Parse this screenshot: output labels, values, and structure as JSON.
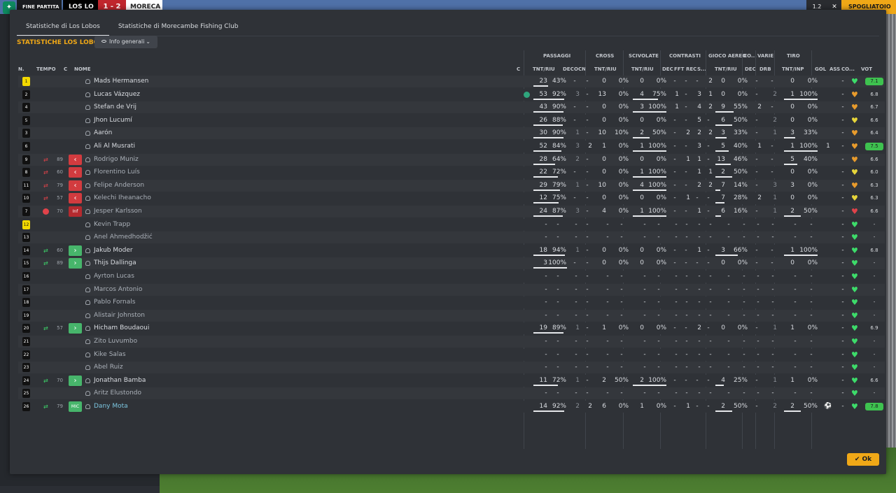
{
  "background": {
    "topbar": {
      "status": "FINE PARTITA",
      "home_team": "LOS LO",
      "score": "1 - 2",
      "away_team": "MORECA",
      "speed": "1.2",
      "close": "✕",
      "button": "SPOGLIATOIO"
    }
  },
  "tabs": [
    {
      "label": "Statistiche di Los Lobos",
      "active": true
    },
    {
      "label": "Statistiche di Morecambe Fishing Club",
      "active": false
    }
  ],
  "section_title": "STATISTICHE LOS LOBOS",
  "view_dropdown": {
    "label": "Info generali"
  },
  "group_headers": [
    "PASSAGGI",
    "CROSS",
    "SCIVOLATE",
    "CONTRASTI",
    "GIOCO AEREO",
    "CO...",
    "VARIE",
    "TIRO"
  ],
  "columns": [
    "N.",
    "TEMPO",
    "C",
    "NOME",
    "C",
    "TNT/RIU",
    "DEC",
    "OCN",
    "TNT/RIU",
    "TNT/RIU",
    "DEC",
    "FFT",
    "REC",
    "S...",
    "TNT/RIU",
    "DEC",
    "DRB",
    "TNT/INP",
    "GOL",
    "ASS",
    "CO...",
    "VOT"
  ],
  "colors": {
    "accent": "#f0a817",
    "heart_green": "#3ddc6a",
    "heart_orange": "#e89b2c",
    "heart_yellow": "#e6d53a",
    "red": "#d23b3f"
  },
  "players": [
    {
      "n": "1",
      "gk": true,
      "time": "",
      "sub": "",
      "chip": "",
      "name": "Mads Hermansen",
      "style": "",
      "cap": false,
      "pass": [
        "23",
        "43%"
      ],
      "pass_dec": "-",
      "pass_ocn": "-",
      "cross": [
        "0",
        "0%"
      ],
      "tackle": [
        "0",
        "0%"
      ],
      "con_dec": "-",
      "con_fft": "-",
      "con_rec": "-",
      "con_s": "2",
      "air": [
        "0",
        "0%"
      ],
      "co": "-",
      "drb": "-",
      "shot": [
        "0",
        "0%"
      ],
      "gol": "",
      "ass": "-",
      "heart": "green",
      "vot": "7.1",
      "vot_bg": "#3ec24f"
    },
    {
      "n": "2",
      "gk": false,
      "time": "",
      "sub": "",
      "chip": "",
      "name": "Lucas Vázquez",
      "style": "",
      "cap": true,
      "pass": [
        "53",
        "92%"
      ],
      "pass_dec": "3",
      "pass_ocn": "-",
      "cross": [
        "13",
        "0%"
      ],
      "tackle": [
        "4",
        "75%"
      ],
      "con_dec": "1",
      "con_fft": "-",
      "con_rec": "3",
      "con_s": "1",
      "air": [
        "0",
        "0%"
      ],
      "co": "-",
      "drb": "2",
      "shot": [
        "1",
        "100%"
      ],
      "gol": "",
      "ass": "-",
      "heart": "orange",
      "vot": "6.8",
      "vot_bg": ""
    },
    {
      "n": "4",
      "gk": false,
      "time": "",
      "sub": "",
      "chip": "",
      "name": "Stefan de Vrij",
      "style": "",
      "cap": false,
      "pass": [
        "43",
        "90%"
      ],
      "pass_dec": "-",
      "pass_ocn": "-",
      "cross": [
        "0",
        "0%"
      ],
      "tackle": [
        "3",
        "100%"
      ],
      "con_dec": "1",
      "con_fft": "-",
      "con_rec": "4",
      "con_s": "2",
      "air": [
        "9",
        "55%"
      ],
      "co": "2",
      "drb": "-",
      "shot": [
        "0",
        "0%"
      ],
      "gol": "",
      "ass": "-",
      "heart": "orange",
      "vot": "6.7",
      "vot_bg": ""
    },
    {
      "n": "5",
      "gk": false,
      "time": "",
      "sub": "",
      "chip": "",
      "name": "Jhon Lucumí",
      "style": "",
      "cap": false,
      "pass": [
        "26",
        "88%"
      ],
      "pass_dec": "-",
      "pass_ocn": "-",
      "cross": [
        "0",
        "0%"
      ],
      "tackle": [
        "0",
        "0%"
      ],
      "con_dec": "-",
      "con_fft": "-",
      "con_rec": "5",
      "con_s": "-",
      "air": [
        "6",
        "50%"
      ],
      "co": "-",
      "drb": "2",
      "shot": [
        "0",
        "0%"
      ],
      "gol": "",
      "ass": "-",
      "heart": "yellow",
      "vot": "6.6",
      "vot_bg": ""
    },
    {
      "n": "3",
      "gk": false,
      "time": "",
      "sub": "",
      "chip": "",
      "name": "Aarón",
      "style": "",
      "cap": false,
      "pass": [
        "30",
        "90%"
      ],
      "pass_dec": "1",
      "pass_ocn": "-",
      "cross": [
        "10",
        "10%"
      ],
      "tackle": [
        "2",
        "50%"
      ],
      "con_dec": "-",
      "con_fft": "2",
      "con_rec": "2",
      "con_s": "2",
      "air": [
        "3",
        "33%"
      ],
      "co": "-",
      "drb": "1",
      "shot": [
        "3",
        "33%"
      ],
      "gol": "",
      "ass": "-",
      "heart": "orange",
      "vot": "6.4",
      "vot_bg": ""
    },
    {
      "n": "6",
      "gk": false,
      "time": "",
      "sub": "",
      "chip": "",
      "name": "Ali Al Musrati",
      "style": "",
      "cap": false,
      "pass": [
        "52",
        "84%"
      ],
      "pass_dec": "3",
      "pass_ocn": "2",
      "cross": [
        "1",
        "0%"
      ],
      "tackle": [
        "1",
        "100%"
      ],
      "con_dec": "-",
      "con_fft": "-",
      "con_rec": "3",
      "con_s": "-",
      "air": [
        "5",
        "40%"
      ],
      "co": "1",
      "drb": "-",
      "shot": [
        "1",
        "100%"
      ],
      "gol": "1",
      "ass": "-",
      "heart": "orange",
      "vot": "7.5",
      "vot_bg": "#3ec24f"
    },
    {
      "n": "9",
      "gk": false,
      "time": "89",
      "sub": "out",
      "chip": "red",
      "name": "Rodrigo Muniz",
      "style": "dim",
      "cap": false,
      "pass": [
        "28",
        "64%"
      ],
      "pass_dec": "2",
      "pass_ocn": "-",
      "cross": [
        "0",
        "0%"
      ],
      "tackle": [
        "0",
        "0%"
      ],
      "con_dec": "-",
      "con_fft": "1",
      "con_rec": "1",
      "con_s": "-",
      "air": [
        "13",
        "46%"
      ],
      "co": "-",
      "drb": "-",
      "shot": [
        "5",
        "40%"
      ],
      "gol": "",
      "ass": "-",
      "heart": "orange",
      "vot": "6.6",
      "vot_bg": ""
    },
    {
      "n": "8",
      "gk": false,
      "time": "60",
      "sub": "out",
      "chip": "red",
      "name": "Florentino Luís",
      "style": "dim",
      "cap": false,
      "pass": [
        "22",
        "72%"
      ],
      "pass_dec": "-",
      "pass_ocn": "-",
      "cross": [
        "0",
        "0%"
      ],
      "tackle": [
        "1",
        "100%"
      ],
      "con_dec": "-",
      "con_fft": "-",
      "con_rec": "1",
      "con_s": "1",
      "air": [
        "2",
        "50%"
      ],
      "co": "-",
      "drb": "-",
      "shot": [
        "0",
        "0%"
      ],
      "gol": "",
      "ass": "-",
      "heart": "yellow",
      "vot": "6.0",
      "vot_bg": ""
    },
    {
      "n": "11",
      "gk": false,
      "time": "79",
      "sub": "out",
      "chip": "red",
      "name": "Felipe Anderson",
      "style": "dim",
      "cap": false,
      "pass": [
        "29",
        "79%"
      ],
      "pass_dec": "1",
      "pass_ocn": "-",
      "cross": [
        "10",
        "0%"
      ],
      "tackle": [
        "4",
        "100%"
      ],
      "con_dec": "-",
      "con_fft": "-",
      "con_rec": "2",
      "con_s": "2",
      "air": [
        "7",
        "14%"
      ],
      "co": "-",
      "drb": "3",
      "shot": [
        "3",
        "0%"
      ],
      "gol": "",
      "ass": "-",
      "heart": "orange",
      "vot": "6.3",
      "vot_bg": ""
    },
    {
      "n": "10",
      "gk": false,
      "time": "57",
      "sub": "out",
      "chip": "red",
      "name": "Kelechi Iheanacho",
      "style": "dim",
      "cap": false,
      "pass": [
        "12",
        "75%"
      ],
      "pass_dec": "-",
      "pass_ocn": "-",
      "cross": [
        "0",
        "0%"
      ],
      "tackle": [
        "0",
        "0%"
      ],
      "con_dec": "-",
      "con_fft": "1",
      "con_rec": "-",
      "con_s": "-",
      "air": [
        "7",
        "28%"
      ],
      "co": "2",
      "drb": "1",
      "shot": [
        "0",
        "0%"
      ],
      "gol": "",
      "ass": "-",
      "heart": "yellow",
      "vot": "6.3",
      "vot_bg": ""
    },
    {
      "n": "7",
      "gk": false,
      "time": "70",
      "sub": "inj",
      "chip": "darkred",
      "chip_text": "Inf",
      "name": "Jesper Karlsson",
      "style": "dim",
      "cap": false,
      "pass": [
        "24",
        "87%"
      ],
      "pass_dec": "3",
      "pass_ocn": "-",
      "cross": [
        "4",
        "0%"
      ],
      "tackle": [
        "1",
        "100%"
      ],
      "con_dec": "-",
      "con_fft": "-",
      "con_rec": "1",
      "con_s": "-",
      "air": [
        "6",
        "16%"
      ],
      "co": "-",
      "drb": "1",
      "shot": [
        "2",
        "50%"
      ],
      "gol": "",
      "ass": "-",
      "heart": "red",
      "vot": "6.6",
      "vot_bg": ""
    },
    {
      "n": "12",
      "gk": true,
      "time": "",
      "sub": "",
      "chip": "",
      "name": "Kevin Trapp",
      "style": "dim",
      "cap": false,
      "empty": true,
      "heart": "green",
      "vot": "-"
    },
    {
      "n": "13",
      "gk": false,
      "time": "",
      "sub": "",
      "chip": "",
      "name": "Anel Ahmedhodžić",
      "style": "dim",
      "cap": false,
      "empty": true,
      "heart": "green",
      "vot": "-"
    },
    {
      "n": "14",
      "gk": false,
      "time": "60",
      "sub": "in",
      "chip": "green",
      "name": "Jakub Moder",
      "style": "",
      "cap": false,
      "pass": [
        "18",
        "94%"
      ],
      "pass_dec": "1",
      "pass_ocn": "-",
      "cross": [
        "0",
        "0%"
      ],
      "tackle": [
        "0",
        "0%"
      ],
      "con_dec": "-",
      "con_fft": "-",
      "con_rec": "1",
      "con_s": "-",
      "air": [
        "3",
        "66%"
      ],
      "co": "-",
      "drb": "-",
      "shot": [
        "1",
        "100%"
      ],
      "gol": "",
      "ass": "-",
      "heart": "green",
      "vot": "6.8",
      "vot_bg": ""
    },
    {
      "n": "15",
      "gk": false,
      "time": "89",
      "sub": "in",
      "chip": "green",
      "name": "Thijs Dallinga",
      "style": "",
      "cap": false,
      "pass": [
        "3",
        "100%"
      ],
      "pass_dec": "-",
      "pass_ocn": "-",
      "cross": [
        "0",
        "0%"
      ],
      "tackle": [
        "0",
        "0%"
      ],
      "con_dec": "-",
      "con_fft": "-",
      "con_rec": "-",
      "con_s": "-",
      "air": [
        "0",
        "0%"
      ],
      "co": "-",
      "drb": "-",
      "shot": [
        "0",
        "0%"
      ],
      "gol": "",
      "ass": "-",
      "heart": "green",
      "vot": "-",
      "vot_bg": ""
    },
    {
      "n": "16",
      "gk": false,
      "time": "",
      "sub": "",
      "chip": "",
      "name": "Ayrton Lucas",
      "style": "dim",
      "cap": false,
      "empty": true,
      "heart": "green",
      "vot": "-"
    },
    {
      "n": "17",
      "gk": false,
      "time": "",
      "sub": "",
      "chip": "",
      "name": "Marcos Antonio",
      "style": "dim",
      "cap": false,
      "empty": true,
      "heart": "green",
      "vot": "-"
    },
    {
      "n": "18",
      "gk": false,
      "time": "",
      "sub": "",
      "chip": "",
      "name": "Pablo Fornals",
      "style": "dim",
      "cap": false,
      "empty": true,
      "heart": "green",
      "vot": "-"
    },
    {
      "n": "19",
      "gk": false,
      "time": "",
      "sub": "",
      "chip": "",
      "name": "Alistair Johnston",
      "style": "dim",
      "cap": false,
      "empty": true,
      "heart": "green",
      "vot": "-"
    },
    {
      "n": "20",
      "gk": false,
      "time": "57",
      "sub": "in",
      "chip": "green",
      "name": "Hicham Boudaoui",
      "style": "",
      "cap": false,
      "pass": [
        "19",
        "89%"
      ],
      "pass_dec": "1",
      "pass_ocn": "-",
      "cross": [
        "1",
        "0%"
      ],
      "tackle": [
        "0",
        "0%"
      ],
      "con_dec": "-",
      "con_fft": "-",
      "con_rec": "2",
      "con_s": "-",
      "air": [
        "0",
        "0%"
      ],
      "co": "-",
      "drb": "1",
      "shot": [
        "1",
        "0%"
      ],
      "gol": "",
      "ass": "-",
      "heart": "green",
      "vot": "6.9",
      "vot_bg": ""
    },
    {
      "n": "21",
      "gk": false,
      "time": "",
      "sub": "",
      "chip": "",
      "name": "Zito Luvumbo",
      "style": "dim",
      "cap": false,
      "empty": true,
      "heart": "green",
      "vot": "-"
    },
    {
      "n": "22",
      "gk": false,
      "time": "",
      "sub": "",
      "chip": "",
      "name": "Kike Salas",
      "style": "dim",
      "cap": false,
      "empty": true,
      "heart": "green",
      "vot": "-"
    },
    {
      "n": "23",
      "gk": false,
      "time": "",
      "sub": "",
      "chip": "",
      "name": "Abel Ruiz",
      "style": "dim",
      "cap": false,
      "empty": true,
      "heart": "green",
      "vot": "-"
    },
    {
      "n": "24",
      "gk": false,
      "time": "70",
      "sub": "in",
      "chip": "green",
      "name": "Jonathan Bamba",
      "style": "",
      "cap": false,
      "pass": [
        "11",
        "72%"
      ],
      "pass_dec": "1",
      "pass_ocn": "-",
      "cross": [
        "2",
        "50%"
      ],
      "tackle": [
        "2",
        "100%"
      ],
      "con_dec": "-",
      "con_fft": "-",
      "con_rec": "-",
      "con_s": "-",
      "air": [
        "4",
        "25%"
      ],
      "co": "-",
      "drb": "1",
      "shot": [
        "1",
        "0%"
      ],
      "gol": "",
      "ass": "-",
      "heart": "green",
      "vot": "6.6",
      "vot_bg": ""
    },
    {
      "n": "25",
      "gk": false,
      "time": "",
      "sub": "",
      "chip": "",
      "name": "Aritz Elustondo",
      "style": "dim",
      "cap": false,
      "empty": true,
      "heart": "green",
      "vot": "-"
    },
    {
      "n": "26",
      "gk": false,
      "time": "79",
      "sub": "in",
      "chip": "mid",
      "chip_text": "MIC",
      "name": "Dany Mota",
      "style": "hl",
      "cap": false,
      "pass": [
        "14",
        "92%"
      ],
      "pass_dec": "2",
      "pass_ocn": "2",
      "cross": [
        "6",
        "0%"
      ],
      "tackle": [
        "1",
        "0%"
      ],
      "con_dec": "-",
      "con_fft": "1",
      "con_rec": "-",
      "con_s": "-",
      "air": [
        "2",
        "50%"
      ],
      "co": "-",
      "drb": "2",
      "shot": [
        "2",
        "50%"
      ],
      "gol": "⚽",
      "ass": "-",
      "heart": "green",
      "vot": "7.8",
      "vot_bg": "#3ec24f"
    }
  ],
  "ok_button": {
    "label": "Ok",
    "icon": "check-icon"
  }
}
